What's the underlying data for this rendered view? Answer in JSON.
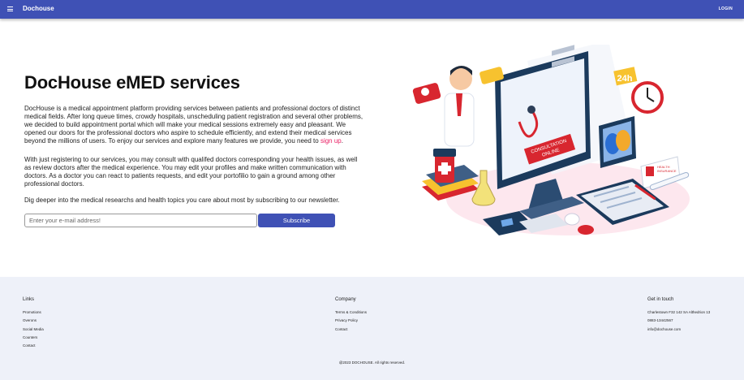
{
  "appbar": {
    "brand": "Dochouse",
    "login_label": "LOGIN"
  },
  "icons": {
    "menu": "menu-icon"
  },
  "colors": {
    "primary": "#3f51b5",
    "link": "#e91e63",
    "footer_bg": "#eef1f9"
  },
  "hero": {
    "title": "DocHouse eMED services",
    "p1_text": "DocHouse is a medical appointment platform providing services between patients and professional doctors of distinct medical fields. After long queue times, crowdy hospitals, unscheduling patient registration and several other problems, we decided to build appointment portal which will make your medical sessions extremely easy and pleasant. We opened our doors for the professional doctors who aspire to schedule efficiently, and extend their medical services beyond the millions of users. To enjoy our services and explore many features we provide, you need to ",
    "p1_link": "sign up",
    "p1_end": ".",
    "p2": "With just registering to our services, you may consult with qualifed doctors corresponding your health issues, as well as review doctors after the medical experience. You may edit your profiles and make written communication with doctors. As a doctor you can react to patients requests, and edit your portofilio to gain a ground among other professional doctors.",
    "p3": "Dig deeper into the medical researchs and health topics you care about most by subscribing to our newsletter."
  },
  "newsletter": {
    "email_placeholder": "Enter your e-mail address!",
    "email_value": "",
    "subscribe_label": "Subscribe"
  },
  "illustration": {
    "screen_label_1": "CONSULTATION",
    "screen_label_2": "ONLINE",
    "clock_label": "24h",
    "insurance_label_1": "HEALTH",
    "insurance_label_2": "INSURANCE"
  },
  "footer": {
    "links": {
      "heading": "Links",
      "items": [
        "Promotions",
        "Overons",
        "Social Media",
        "Counters",
        "Contact"
      ]
    },
    "company": {
      "heading": "Company",
      "items": [
        "Terms & Conditions",
        "Privacy Policy",
        "Contact"
      ]
    },
    "contact": {
      "heading": "Get in touch",
      "address": "Charlestown F32 142 SA Althedrion 13",
      "phone": "0883-13442567",
      "email": "info@dochouse.com"
    },
    "copyright": "@2023 DOCHOUSE. All rights reserved."
  }
}
